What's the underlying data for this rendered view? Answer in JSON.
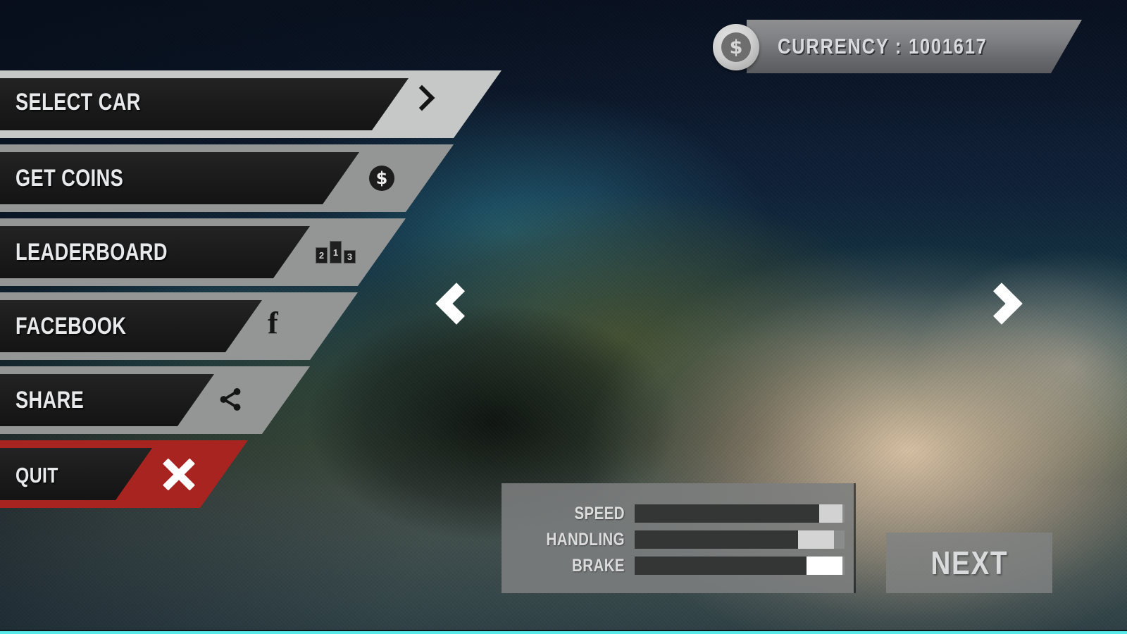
{
  "hud": {
    "currency": {
      "label": "CURRENCY : 1001617",
      "icon": "coin-dollar-icon",
      "amount": "1001617"
    }
  },
  "menu": {
    "items": [
      {
        "label": "SELECT CAR",
        "icon": "chevron-right-icon",
        "frame_color": "#c6c8c8",
        "accent": false
      },
      {
        "label": "GET COINS",
        "icon": "coin-dollar-icon",
        "frame_color": "#949696",
        "accent": false
      },
      {
        "label": "LEADERBOARD",
        "icon": "podium-icon",
        "frame_color": "#949696",
        "accent": false
      },
      {
        "label": "FACEBOOK",
        "icon": "facebook-icon",
        "frame_color": "#949696",
        "accent": false
      },
      {
        "label": "SHARE",
        "icon": "share-icon",
        "frame_color": "#949696",
        "accent": false
      },
      {
        "label": "QUIT",
        "icon": "close-x-icon",
        "frame_color": "#a82420",
        "accent": true
      }
    ],
    "podium_places": [
      "2",
      "1",
      "3"
    ]
  },
  "carousel": {
    "prev_label": "‹",
    "next_label": "›",
    "prev_icon": "chevron-left-icon",
    "next_icon": "chevron-right-icon"
  },
  "stats": {
    "rows": [
      {
        "label": "SPEED",
        "fill_pct": 88,
        "marker_pct": 11
      },
      {
        "label": "HANDLING",
        "fill_pct": 78,
        "marker_pct": 17
      },
      {
        "label": "BRAKE",
        "fill_pct": 82,
        "marker_pct": 17
      }
    ]
  },
  "actions": {
    "next_label": "NEXT"
  },
  "colors": {
    "quit_red": "#a82420",
    "frame_gray": "#949696",
    "frame_light": "#c6c8c8",
    "panel_gray": "#7c7e7e",
    "bottom_strip": "#5ae9e9",
    "text_light": "#e8e9ea"
  }
}
